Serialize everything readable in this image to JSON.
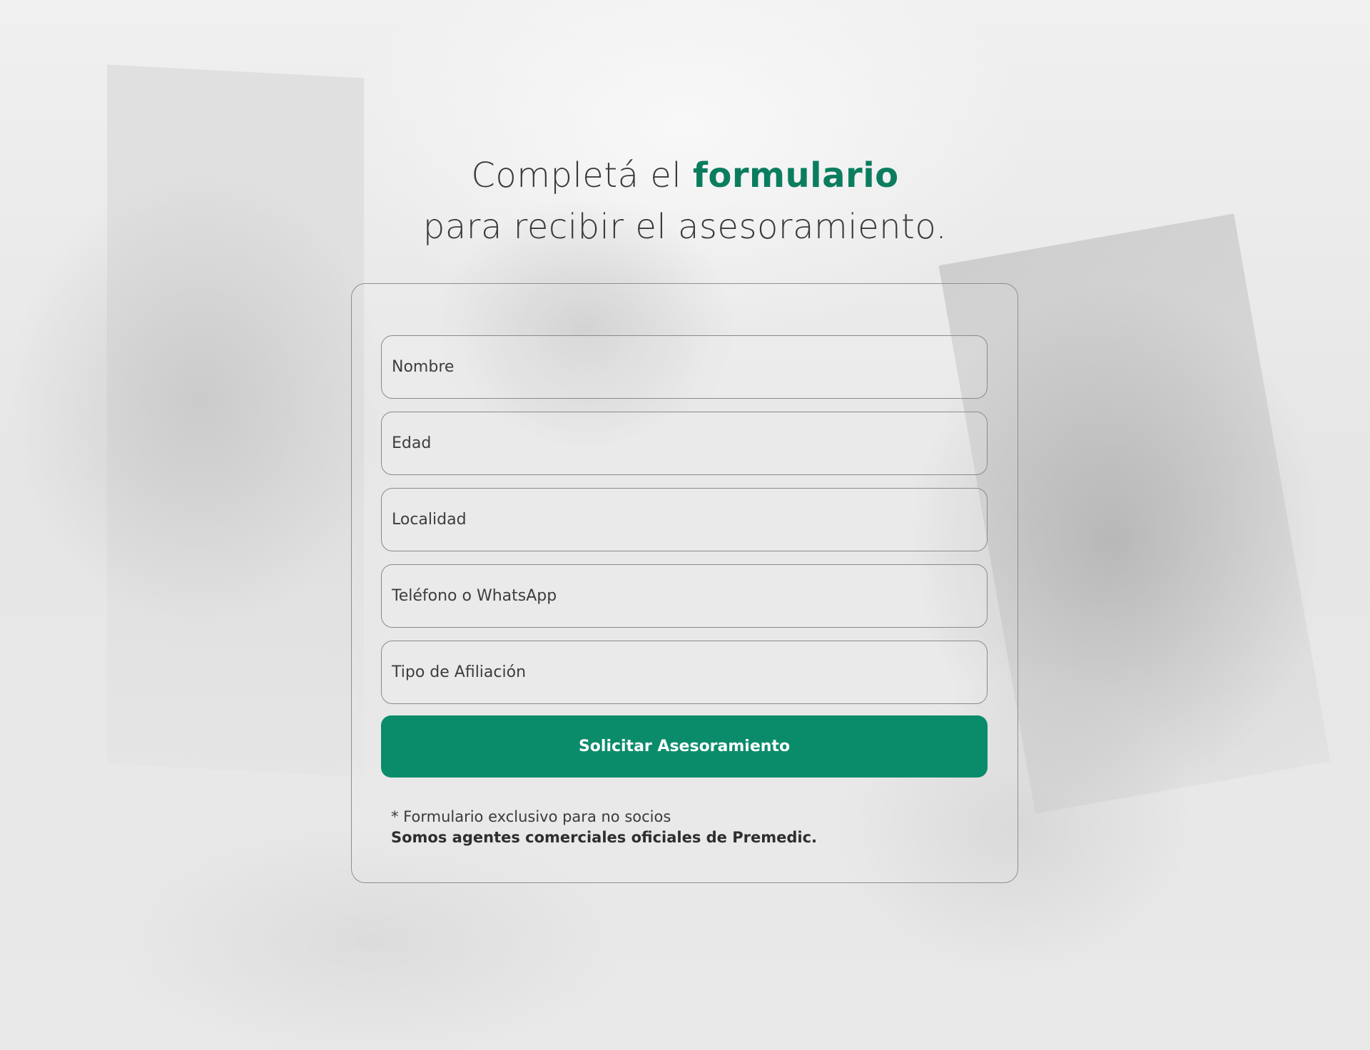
{
  "heading": {
    "line1_prefix": "Completá el ",
    "line1_accent": "formulario",
    "line2": "para recibir el asesoramiento."
  },
  "form": {
    "fields": [
      {
        "placeholder": "Nombre"
      },
      {
        "placeholder": "Edad"
      },
      {
        "placeholder": "Localidad"
      },
      {
        "placeholder": "Teléfono o WhatsApp"
      },
      {
        "placeholder": "Tipo de Afiliación"
      }
    ],
    "submit_label": "Solicitar Asesoramiento",
    "note": "* Formulario exclusivo para no socios",
    "note_strong": "Somos agentes comerciales oficiales de Premedic."
  },
  "colors": {
    "accent": "#0b7d5f",
    "button": "#0a8c6b",
    "text": "#3a3a3a"
  }
}
